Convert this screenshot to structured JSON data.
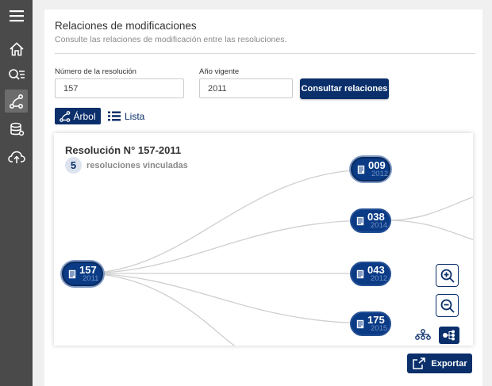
{
  "sidebar": {
    "items": [
      {
        "icon": "menu-icon"
      },
      {
        "icon": "home-icon"
      },
      {
        "icon": "search-list-icon"
      },
      {
        "icon": "relations-icon",
        "active": true
      },
      {
        "icon": "database-icon"
      },
      {
        "icon": "cloud-upload-icon"
      }
    ]
  },
  "header": {
    "title": "Relaciones de modificaciones",
    "subtitle": "Consulte las relaciones de modificación entre las resoluciones."
  },
  "form": {
    "resolution_label": "Número de la resolución",
    "resolution_value": "157",
    "year_label": "Año vigente",
    "year_value": "2011",
    "submit_label": "Consultar relaciones"
  },
  "view_tabs": {
    "tree_label": "Árbol",
    "list_label": "Lista",
    "active": "tree"
  },
  "tree": {
    "title": "Resolución N° 157-2011",
    "count": "5",
    "count_label": "resoluciones vinculadas",
    "root": {
      "number": "157",
      "year": "2011"
    },
    "children": [
      {
        "number": "009",
        "year": "2012"
      },
      {
        "number": "038",
        "year": "2014"
      },
      {
        "number": "043",
        "year": "2012"
      },
      {
        "number": "175",
        "year": "2015"
      }
    ]
  },
  "actions": {
    "export_label": "Exportar"
  },
  "colors": {
    "primary": "#0a2f6b",
    "sidebar": "#4a4a4a",
    "node": "#0b3b85",
    "node_year": "#6f8fc6",
    "link": "#cfcfcf"
  }
}
